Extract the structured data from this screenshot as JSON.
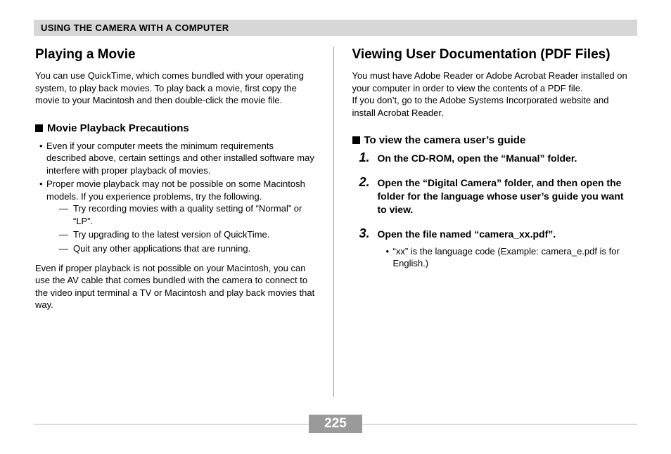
{
  "header": "USING THE CAMERA WITH A COMPUTER",
  "left": {
    "title": "Playing a Movie",
    "intro": "You can use QuickTime, which comes bundled with your operating system, to play back movies. To play back a movie, first copy the movie to your Macintosh and then double-click the movie file.",
    "sub1": "Movie Playback Precautions",
    "b1": "Even if your computer meets the minimum requirements described above, certain settings and other installed software may interfere with proper playback of movies.",
    "b2": "Proper movie playback may not be possible on some Macintosh models. If you experience problems, try the following.",
    "d1": "Try recording movies with a quality setting of “Normal” or “LP”.",
    "d2": "Try upgrading to the latest version of QuickTime.",
    "d3": "Quit any other applications that are running.",
    "para": "Even if proper playback is not possible on your Macintosh, you can use the AV cable that comes bundled with the camera to connect to the video input terminal a TV or Macintosh and play back movies that way."
  },
  "right": {
    "title": "Viewing User Documentation (PDF Files)",
    "intro1": "You must have Adobe Reader or Adobe Acrobat Reader installed on your computer in order to view the contents of a PDF file.",
    "intro2": "If you don’t, go to the Adobe Systems Incorporated website and install Acrobat Reader.",
    "sub1": "To view the camera user’s guide",
    "s1": "On the CD-ROM, open the “Manual” folder.",
    "s2": "Open the “Digital Camera” folder, and then open the folder for the language whose user’s guide you want to view.",
    "s3": "Open the file named “camera_xx.pdf”.",
    "s3note": "“xx” is the language code (Example: camera_e.pdf is for English.)"
  },
  "page": "225"
}
